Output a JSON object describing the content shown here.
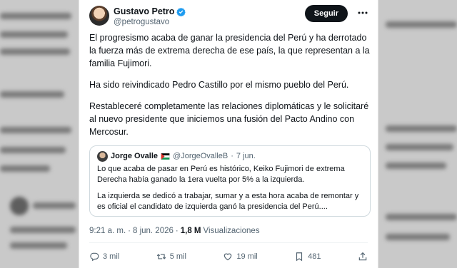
{
  "author": {
    "display_name": "Gustavo Petro",
    "handle": "@petrogustavo",
    "follow_label": "Seguir"
  },
  "tweet": {
    "paragraphs": [
      "El progresismo acaba de ganar la presidencia del Perú y ha derrotado la fuerza más de extrema derecha de ese país, la que representan a la familia Fujimori.",
      "Ha sido reivindicado Pedro Castillo por el mismo pueblo del Perú.",
      "Restableceré completamente las relaciones diplomáticas y le solicitaré al nuevo presidente que iniciemos una fusión del Pacto Andino con Mercosur."
    ]
  },
  "quoted": {
    "display_name": "Jorge Ovalle",
    "handle": "@JorgeOvalleB",
    "separator": "·",
    "date": "7 jun.",
    "paragraphs": [
      "Lo que acaba de pasar en Perú es histórico, Keiko Fujimori de extrema Derecha había ganado la 1era vuelta por 5% a la izquierda.",
      "La izquierda se dedicó a trabajar, sumar y a esta hora acaba de remontar y es oficial el candidato de izquierda ganó la presidencia del Perú...."
    ]
  },
  "meta": {
    "time": "9:21 a. m.",
    "separator": "·",
    "date": "8 jun. 2026",
    "views_count": "1,8 M",
    "views_label": "Visualizaciones"
  },
  "actions": {
    "replies": "3 mil",
    "reposts": "5 mil",
    "likes": "19 mil",
    "bookmarks": "481"
  },
  "colors": {
    "text": "#0f1419",
    "secondary": "#536471",
    "verified": "#1d9bf0",
    "follow_bg": "#0f1419"
  },
  "icons": [
    "verified-badge-icon",
    "more-icon",
    "palestine-flag-icon",
    "reply-icon",
    "repost-icon",
    "like-icon",
    "bookmark-icon",
    "share-icon"
  ]
}
